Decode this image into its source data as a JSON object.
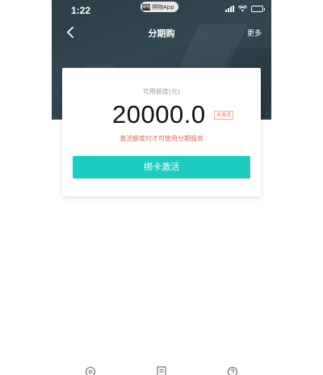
{
  "status_bar": {
    "time": "1:22",
    "app_pill_label": "得物App",
    "app_logo_text": "得物"
  },
  "nav": {
    "title": "分期购",
    "more_label": "更多"
  },
  "credit": {
    "label": "可用额度(元)",
    "amount": "20000.0",
    "status_badge": "未激活",
    "hint": "激活额度时才可使用分期服务",
    "activate_label": "绑卡激活"
  },
  "tab_bar": {
    "icons": [
      "location-icon",
      "document-icon",
      "help-icon"
    ]
  },
  "colors": {
    "hero": "#2f434c",
    "accent": "#1ecbc0",
    "warning": "#e56a5a"
  }
}
